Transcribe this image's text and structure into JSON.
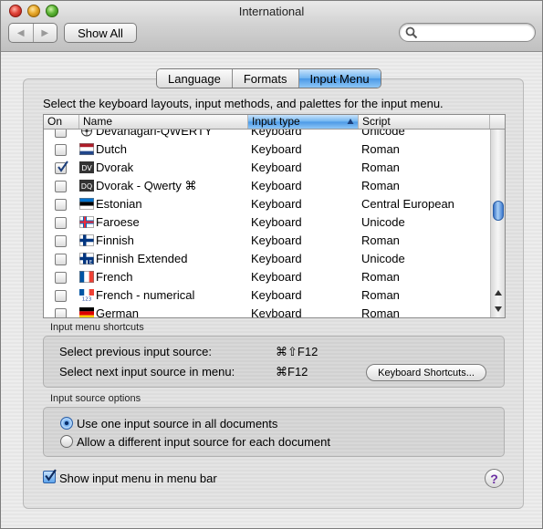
{
  "window": {
    "title": "International"
  },
  "toolbar": {
    "back_label": "◀",
    "forward_label": "▶",
    "show_all_label": "Show All",
    "search_value": ""
  },
  "tabs": [
    {
      "label": "Language",
      "active": false
    },
    {
      "label": "Formats",
      "active": false
    },
    {
      "label": "Input Menu",
      "active": true
    }
  ],
  "intro_text": "Select the keyboard layouts, input methods, and palettes for the input menu.",
  "table": {
    "columns": {
      "on": "On",
      "name": "Name",
      "type": "Input type",
      "script": "Script"
    },
    "rows": [
      {
        "checked": false,
        "flag": "devanagari",
        "name": "Devanagari-QWERTY",
        "type": "Keyboard",
        "script": "Unicode"
      },
      {
        "checked": false,
        "flag": "netherlands",
        "name": "Dutch",
        "type": "Keyboard",
        "script": "Roman"
      },
      {
        "checked": true,
        "flag": "dv",
        "name": "Dvorak",
        "type": "Keyboard",
        "script": "Roman"
      },
      {
        "checked": false,
        "flag": "dq",
        "name": "Dvorak - Qwerty ⌘",
        "type": "Keyboard",
        "script": "Roman"
      },
      {
        "checked": false,
        "flag": "estonia",
        "name": "Estonian",
        "type": "Keyboard",
        "script": "Central European"
      },
      {
        "checked": false,
        "flag": "faroe",
        "name": "Faroese",
        "type": "Keyboard",
        "script": "Unicode"
      },
      {
        "checked": false,
        "flag": "finland",
        "name": "Finnish",
        "type": "Keyboard",
        "script": "Roman"
      },
      {
        "checked": false,
        "flag": "finland-ext",
        "name": "Finnish Extended",
        "type": "Keyboard",
        "script": "Unicode"
      },
      {
        "checked": false,
        "flag": "france",
        "name": "French",
        "type": "Keyboard",
        "script": "Roman"
      },
      {
        "checked": false,
        "flag": "france-123",
        "name": "French - numerical",
        "type": "Keyboard",
        "script": "Roman"
      },
      {
        "checked": false,
        "flag": "germany",
        "name": "German",
        "type": "Keyboard",
        "script": "Roman"
      }
    ]
  },
  "shortcuts": {
    "section_label": "Input menu shortcuts",
    "prev_label": "Select previous input source:",
    "prev_key": "⌘⇧F12",
    "next_label": "Select next input source in menu:",
    "next_key": "⌘F12",
    "button_label": "Keyboard Shortcuts..."
  },
  "source_options": {
    "section_label": "Input source options",
    "option_all": "Use one input source in all documents",
    "option_each": "Allow a different input source for each document",
    "selected": "all"
  },
  "show_menu": {
    "label": "Show input menu in menu bar",
    "checked": true
  },
  "help_label": "?",
  "flag_text": {
    "dv": "DV",
    "dq": "DQ",
    "num": "123"
  },
  "colors": {
    "accent": "#4a98e6",
    "dutch_red": "#ae1c28",
    "dutch_blue": "#21468b",
    "finnish_blue": "#003580",
    "french_blue": "#0055a4",
    "french_red": "#ef4135"
  }
}
